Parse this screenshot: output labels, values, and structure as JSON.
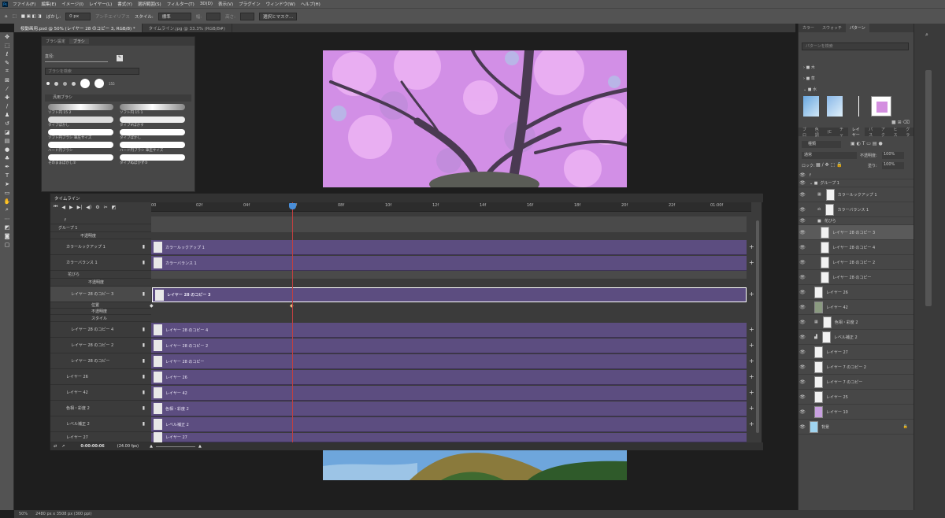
{
  "menu": [
    "ファイル(F)",
    "編集(E)",
    "イメージ(I)",
    "レイヤー(L)",
    "書式(Y)",
    "選択範囲(S)",
    "フィルター(T)",
    "3D(D)",
    "表示(V)",
    "プラグイン",
    "ウィンドウ(W)",
    "ヘルプ(H)"
  ],
  "options": {
    "blur_label": "ぼかし:",
    "blur_value": "0 px",
    "antialias": "アンチエイリアス",
    "style_label": "スタイル:",
    "style_value": "標準",
    "width_label": "幅:",
    "height_label": "高さ:",
    "mask_button": "選択とマスク..."
  },
  "doc_tabs": [
    "桜動画用.psd @ 50% (レイヤー 28 のコピー 3, RGB/8) *",
    "タイムライン.jpg @ 33.3% (RGB/8#)"
  ],
  "brush_panel": {
    "tabs": [
      "ブラシ設定",
      "ブラシ"
    ],
    "size_label": "直径:",
    "search_placeholder": "ブラシを検索",
    "size_badge": "155",
    "group": "汎用ブラシ",
    "items": [
      "ソフト円 15 2",
      "ソフト円 15 1",
      "タイプぼかし",
      "タイプ#ぼかす",
      "ソフト円ブラシ 筆圧サイズ",
      "タイプぼかし",
      "ハード円ブラシ",
      "ハード円ブラシ 筆圧サイズ",
      "そのままぼかし②",
      "タイプぬぼかず②"
    ]
  },
  "timeline": {
    "title": "タイムライン",
    "ticks": [
      "00",
      "02f",
      "04f",
      "06f",
      "08f",
      "10f",
      "12f",
      "14f",
      "16f",
      "18f",
      "20f",
      "22f",
      "01:00f"
    ],
    "time": "0:00:00:06",
    "fps": "(24.00 fps)",
    "rows": [
      "f",
      "グループ 1",
      "不透明度",
      "カラールックアップ 1",
      "カラーバランス 1",
      "花びら",
      "不透明度",
      "レイヤー 28 のコピー 3",
      "位置",
      "不透明度",
      "スタイル",
      "レイヤー 28 のコピー 4",
      "レイヤー 28 のコピー 2",
      "レイヤー 28 のコピー",
      "レイヤー 26",
      "レイヤー 42",
      "色相・彩度 2",
      "レベル補正 2",
      "レイヤー 27"
    ],
    "clips": [
      "カラールックアップ 1",
      "カラーバランス 1",
      "レイヤー 28 のコピー 3",
      "レイヤー 28 のコピー 4",
      "レイヤー 28 のコピー 2",
      "レイヤー 28 のコピー",
      "レイヤー 26",
      "レイヤー 42",
      "色相・彩度 2",
      "レベル補正 2",
      "レイヤー 27"
    ]
  },
  "right_top": {
    "tabs": [
      "カラー",
      "スウォッチ",
      "パターン"
    ],
    "search_placeholder": "パターンを検索",
    "folders": [
      "木",
      "草",
      "水"
    ]
  },
  "layers_panel": {
    "tabs": [
      "ブロ",
      "色調",
      "(C",
      "チャ",
      "レイヤー",
      "パス",
      "アク",
      "ヒス",
      "グラ"
    ],
    "kind": "種類",
    "blend": "通常",
    "opacity_label": "不透明度:",
    "opacity": "100%",
    "lock_label": "ロック:",
    "fill_label": "塗り:",
    "fill": "100%",
    "layers": [
      "f",
      "グループ 1",
      "カラールックアップ 1",
      "カラーバランス 1",
      "花びら",
      "レイヤー 28 のコピー 3",
      "レイヤー 28 のコピー 4",
      "レイヤー 28 のコピー 2",
      "レイヤー 28 のコピー",
      "レイヤー 26",
      "レイヤー 42",
      "色相・彩度 2",
      "レベル補正 2",
      "レイヤー 27",
      "レイヤー 7 のコピー 2",
      "レイヤー 7 のコピー",
      "レイヤー 25",
      "レイヤー 10",
      "背景"
    ]
  },
  "status": {
    "zoom": "50%",
    "size": "2480 px x 3508 px (300 ppi)"
  }
}
